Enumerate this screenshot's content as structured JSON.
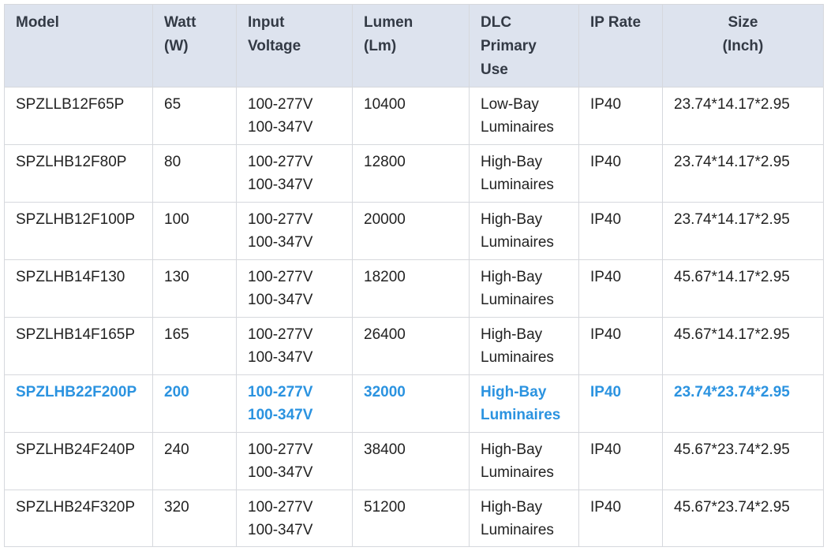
{
  "table": {
    "headers": [
      {
        "lines": [
          "Model"
        ]
      },
      {
        "lines": [
          "Watt",
          "(W)"
        ]
      },
      {
        "lines": [
          "Input",
          "Voltage"
        ]
      },
      {
        "lines": [
          "Lumen",
          "(Lm)"
        ]
      },
      {
        "lines": [
          "DLC",
          "Primary",
          "Use"
        ]
      },
      {
        "lines": [
          "IP Rate"
        ]
      },
      {
        "lines": [
          "Size",
          "(Inch)"
        ]
      }
    ],
    "rows": [
      {
        "model": "SPZLLB12F65P",
        "watt": "65",
        "voltage": [
          "100-277V",
          "100-347V"
        ],
        "lumen": "10400",
        "dlc": [
          "Low-Bay",
          "Luminaires"
        ],
        "ip": "IP40",
        "size": "23.74*14.17*2.95"
      },
      {
        "model": "SPZLHB12F80P",
        "watt": "80",
        "voltage": [
          "100-277V",
          "100-347V"
        ],
        "lumen": "12800",
        "dlc": [
          "High-Bay",
          "Luminaires"
        ],
        "ip": "IP40",
        "size": "23.74*14.17*2.95"
      },
      {
        "model": "SPZLHB12F100P",
        "watt": "100",
        "voltage": [
          "100-277V",
          "100-347V"
        ],
        "lumen": "20000",
        "dlc": [
          "High-Bay",
          "Luminaires"
        ],
        "ip": "IP40",
        "size": "23.74*14.17*2.95"
      },
      {
        "model": "SPZLHB14F130",
        "watt": "130",
        "voltage": [
          "100-277V",
          "100-347V"
        ],
        "lumen": "18200",
        "dlc": [
          "High-Bay",
          "Luminaires"
        ],
        "ip": "IP40",
        "size": "45.67*14.17*2.95"
      },
      {
        "model": "SPZLHB14F165P",
        "watt": "165",
        "voltage": [
          "100-277V",
          "100-347V"
        ],
        "lumen": "26400",
        "dlc": [
          "High-Bay",
          "Luminaires"
        ],
        "ip": "IP40",
        "size": "45.67*14.17*2.95"
      },
      {
        "model": "SPZLHB22F200P",
        "watt": "200",
        "voltage": [
          "100-277V",
          "100-347V"
        ],
        "lumen": "32000",
        "dlc": [
          "High-Bay",
          "Luminaires"
        ],
        "ip": "IP40",
        "size": "23.74*23.74*2.95",
        "highlight": true
      },
      {
        "model": "SPZLHB24F240P",
        "watt": "240",
        "voltage": [
          "100-277V",
          "100-347V"
        ],
        "lumen": "38400",
        "dlc": [
          "High-Bay",
          "Luminaires"
        ],
        "ip": "IP40",
        "size": "45.67*23.74*2.95"
      },
      {
        "model": "SPZLHB24F320P",
        "watt": "320",
        "voltage": [
          "100-277V",
          "100-347V"
        ],
        "lumen": "51200",
        "dlc": [
          "High-Bay",
          "Luminaires"
        ],
        "ip": "IP40",
        "size": "45.67*23.74*2.95"
      }
    ]
  },
  "colors": {
    "header_bg": "#dde3ee",
    "highlight_text": "#2b93e0"
  }
}
